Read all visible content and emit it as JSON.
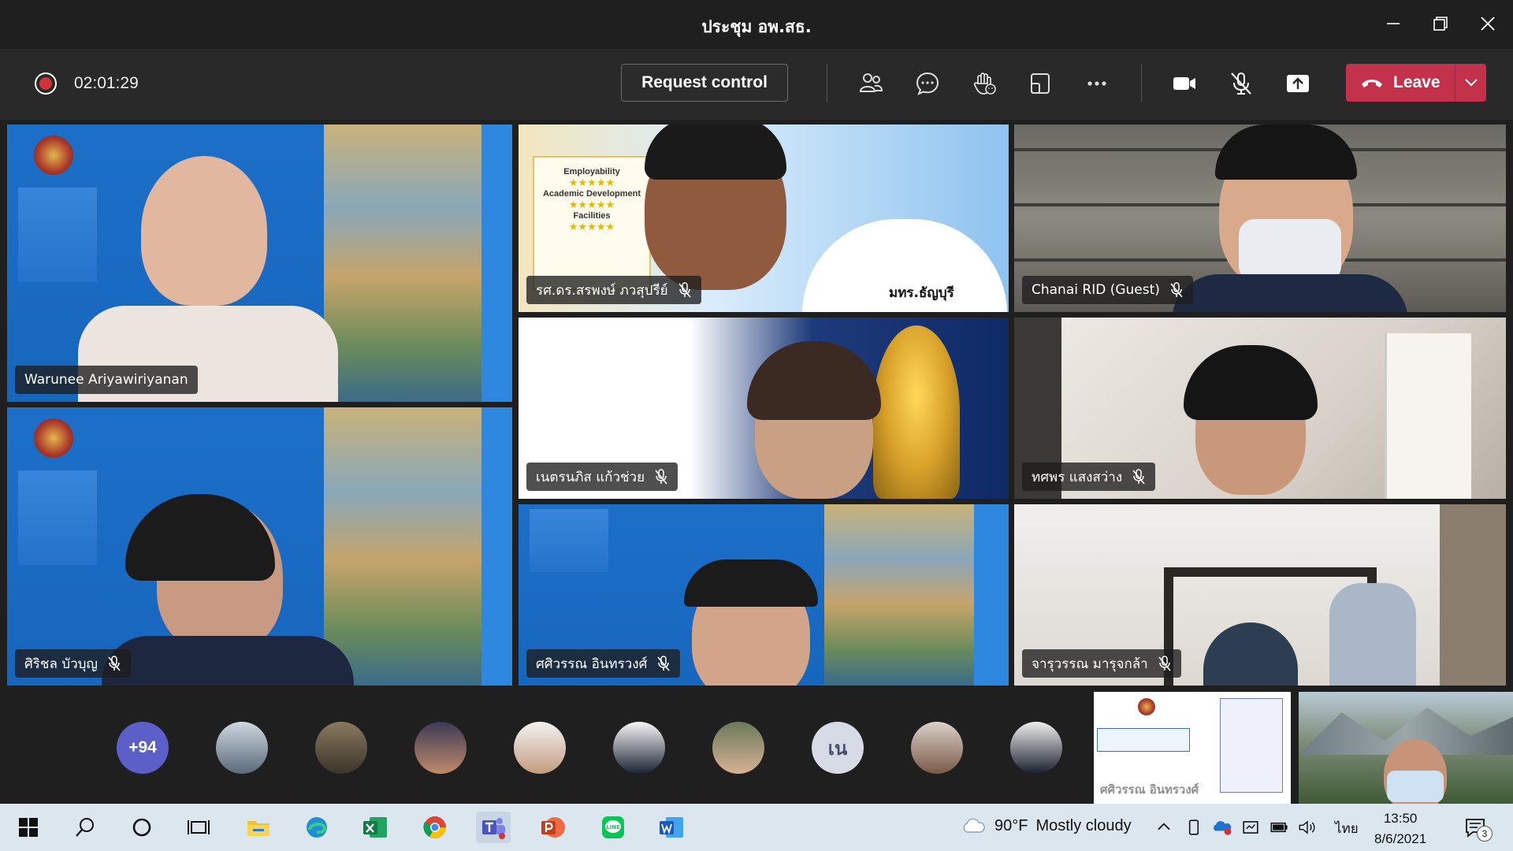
{
  "window": {
    "title": "ประชุม อพ.สธ."
  },
  "meeting_bar": {
    "timer": "02:01:29",
    "request_control_label": "Request control",
    "leave_label": "Leave",
    "recording_color": "#d13438",
    "leave_color": "#c4314b"
  },
  "participants": {
    "tiles": [
      {
        "name": "Warunee Ariyawiriyanan",
        "muted": false
      },
      {
        "name": "รศ.ดร.สรพงษ์ ภวสุปรีย์",
        "muted": true
      },
      {
        "name": "Chanai RID (Guest)",
        "muted": true
      },
      {
        "name": "เนตรนภิส แก้วช่วย",
        "muted": true
      },
      {
        "name": "ทศพร แสงสว่าง",
        "muted": true
      },
      {
        "name": "ศิริชล บัวบุญ",
        "muted": true
      },
      {
        "name": "ศศิวรรณ อินทรวงศ์",
        "muted": true
      },
      {
        "name": "จารุวรรณ มารุจกล้า",
        "muted": true
      }
    ],
    "banner_texts": {
      "rating_lines": [
        "Employability",
        "Academic Development",
        "Facilities"
      ],
      "campus_label": "มทร.ธัญบุรี",
      "overlay_name": "ศศิวรรณ อินทรวงศ์"
    }
  },
  "roster": {
    "overflow_count": "+94",
    "initials": "เน"
  },
  "taskbar": {
    "weather_temp": "90°F",
    "weather_text": "Mostly cloudy",
    "language": "ไทย",
    "time": "13:50",
    "date": "8/6/2021",
    "notification_count": "3"
  }
}
